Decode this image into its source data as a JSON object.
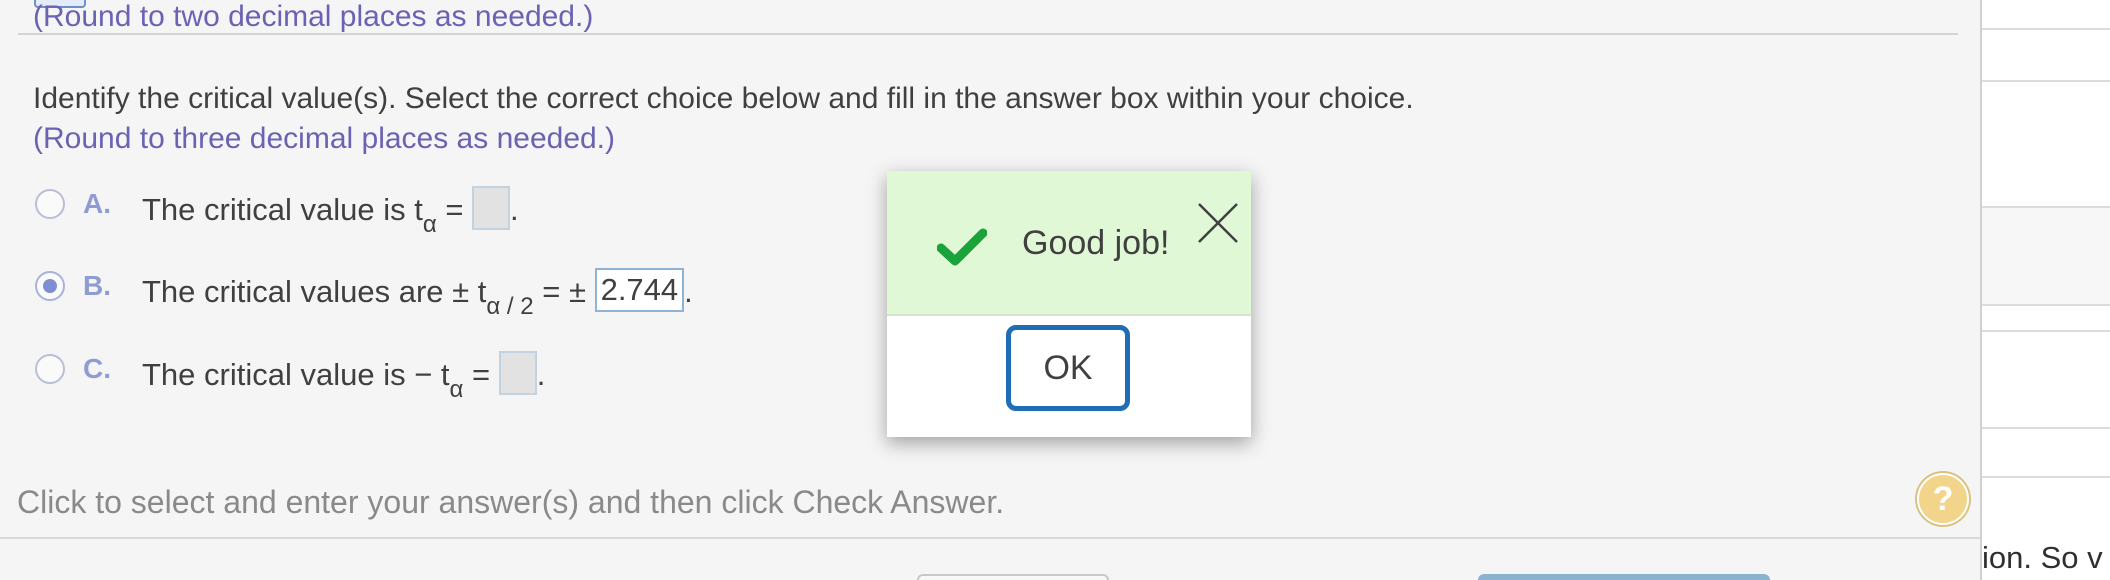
{
  "header": {
    "cut_hint": "(Round to two decimal places as needed.)"
  },
  "question": {
    "instruction": "Identify the critical value(s). Select the correct choice below and fill in the answer box within your choice.",
    "hint": "(Round to three decimal places as needed.)"
  },
  "choices": [
    {
      "letter": "A.",
      "text": "The critical value is t",
      "subscript": "α",
      "equals": " = ",
      "answer": "",
      "period": ".",
      "selected": false
    },
    {
      "letter": "B.",
      "text": "The critical values are  ± t",
      "subscript": "α / 2",
      "equals": " = ± ",
      "answer": "2.744",
      "period": ".",
      "selected": true
    },
    {
      "letter": "C.",
      "text": "The critical value is  − t",
      "subscript": "α",
      "equals": " = ",
      "answer": "",
      "period": ".",
      "selected": false
    }
  ],
  "footer": {
    "instruction": "Click to select and enter your answer(s) and then click Check Answer.",
    "help_label": "?"
  },
  "dialog": {
    "message": "Good job!",
    "ok_label": "OK",
    "check_icon": "checkmark-icon",
    "close_icon": "close-icon"
  },
  "side_panel": {
    "text": "ion. So v"
  },
  "colors": {
    "hint": "#6a62b2",
    "dialog_success_bg": "#e1f8d6",
    "check_green": "#1aa33a",
    "ok_border": "#1f6db4"
  }
}
